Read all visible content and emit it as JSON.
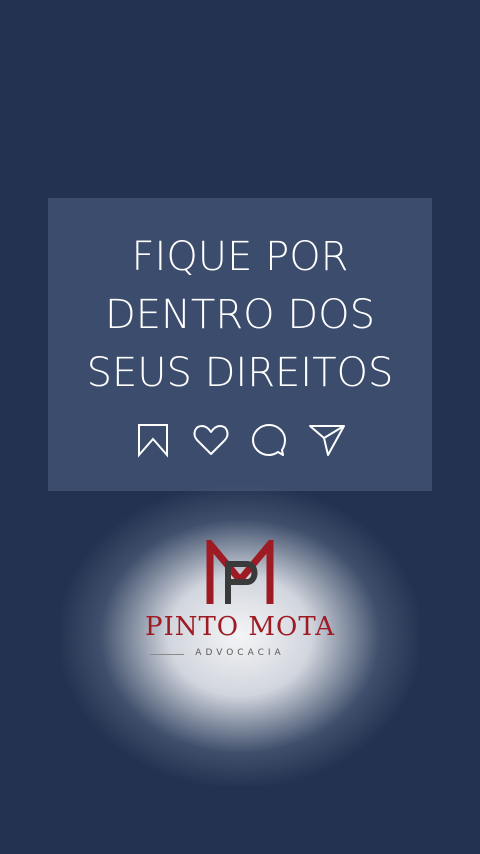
{
  "headline": {
    "line1": "FIQUE POR",
    "line2": "DENTRO DOS",
    "line3": "SEUS DIREITOS"
  },
  "actions": [
    "bookmark-icon",
    "heart-icon",
    "comment-icon",
    "share-icon"
  ],
  "brand": {
    "name": "PINTO MOTA",
    "subtitle": "ADVOCACIA"
  },
  "colors": {
    "background": "#223250",
    "card": "#3b4c6c",
    "brand_red": "#9e1b24",
    "mark_dark": "#3a3a3a"
  }
}
